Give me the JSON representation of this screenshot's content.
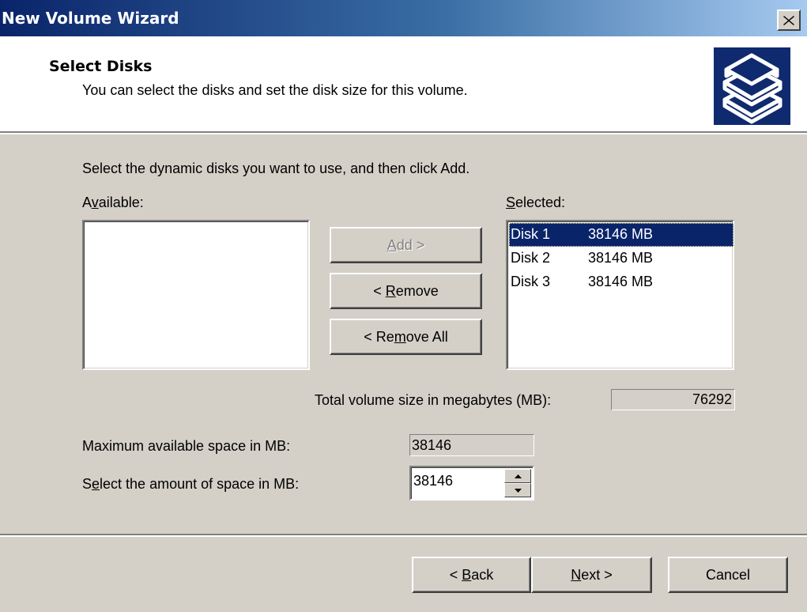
{
  "window": {
    "title": "New Volume Wizard",
    "close_icon": "close-icon"
  },
  "header": {
    "title": "Select Disks",
    "subtitle": "You can select the disks and set the disk size for this volume.",
    "icon": "stacked-disks-icon",
    "icon_bg": "#0f2a6e"
  },
  "body": {
    "instruction": "Select the dynamic disks you want to use, and then click Add.",
    "available_label": {
      "pre": "A",
      "key": "v",
      "post": "ailable:"
    },
    "selected_label": {
      "pre": "",
      "key": "S",
      "post": "elected:"
    },
    "available_items": [],
    "selected_items": [
      {
        "disk": "Disk 1",
        "size": "38146 MB",
        "selected": true
      },
      {
        "disk": "Disk 2",
        "size": "38146 MB",
        "selected": false
      },
      {
        "disk": "Disk 3",
        "size": "38146 MB",
        "selected": false
      }
    ],
    "add_button": {
      "pre": "",
      "key": "A",
      "post": "dd >",
      "enabled": false
    },
    "remove_button": {
      "pre": "< ",
      "key": "R",
      "post": "emove"
    },
    "remove_all_button": {
      "pre": "< Re",
      "key": "m",
      "post": "ove All"
    },
    "total_label": "Total volume size in megabytes (MB):",
    "total_value": "76292",
    "max_label": "Maximum available space in MB:",
    "max_value": "38146",
    "amount_label": {
      "pre": "S",
      "key": "e",
      "post": "lect the amount of space in MB:"
    },
    "amount_value": "38146"
  },
  "footer": {
    "back_button": {
      "pre": "< ",
      "key": "B",
      "post": "ack"
    },
    "next_button": {
      "pre": "",
      "key": "N",
      "post": "ext >"
    },
    "cancel_button": "Cancel"
  },
  "colors": {
    "titlebar_start": "#0a246a",
    "titlebar_end": "#a6caf0",
    "selection": "#0a246a",
    "dialog_bg": "#d4d0c8"
  }
}
